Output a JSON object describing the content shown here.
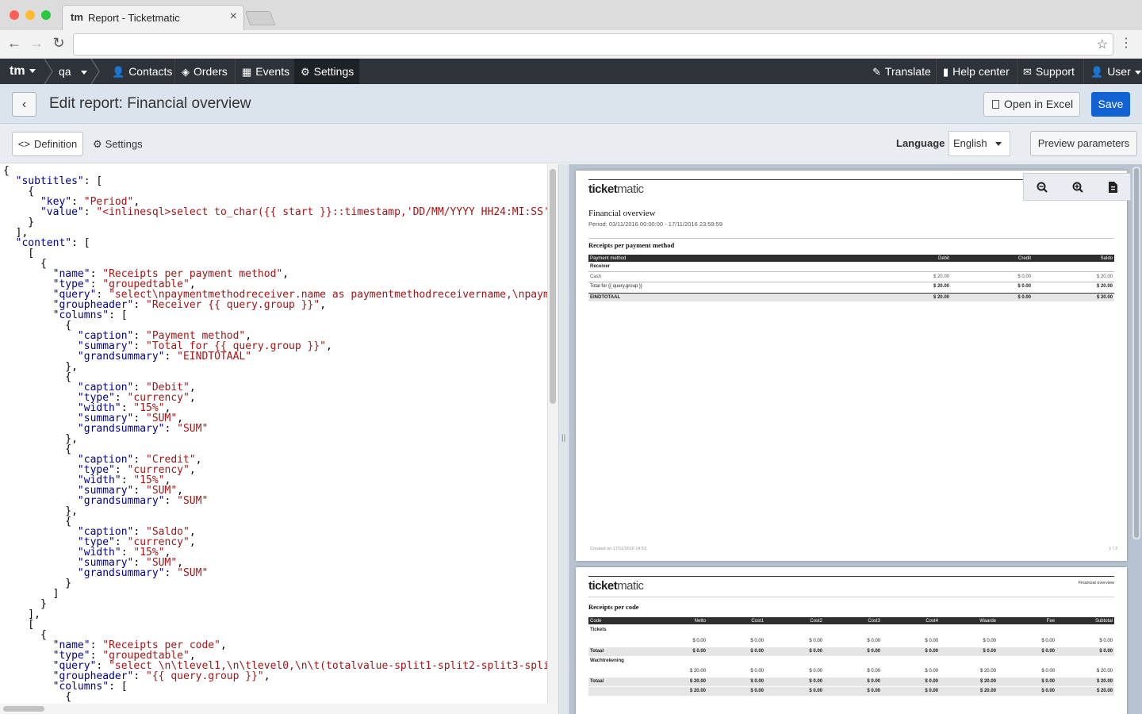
{
  "browser": {
    "tab_title": "Report - Ticketmatic",
    "tab_icon": "tm",
    "url": ""
  },
  "nav": {
    "brand": "tm",
    "account": "qa",
    "items": [
      {
        "label": "Contacts",
        "icon": "user-icon"
      },
      {
        "label": "Orders",
        "icon": "tag-icon"
      },
      {
        "label": "Events",
        "icon": "calendar-icon"
      },
      {
        "label": "Settings",
        "icon": "gear-icon"
      }
    ],
    "right": [
      {
        "label": "Translate",
        "icon": "pencil-icon"
      },
      {
        "label": "Help center",
        "icon": "book-icon"
      },
      {
        "label": "Support",
        "icon": "envelope-icon"
      },
      {
        "label": "User",
        "icon": "user-icon"
      }
    ]
  },
  "header": {
    "title": "Edit report: Financial overview",
    "open_excel": "Open in Excel",
    "save": "Save"
  },
  "subbar": {
    "definition": "Definition",
    "settings": "Settings",
    "language_label": "Language",
    "language_value": "English",
    "preview_params": "Preview parameters"
  },
  "editor": {
    "lines": [
      "{",
      "  \"subtitles\": [",
      "    {",
      "      \"key\": \"Period\",",
      "      \"value\": \"<inlinesql>select to_char({{ start }}::timestamp,'DD/MM/YYYY HH24:MI:SS'",
      "    }",
      "  ],",
      "  \"content\": [",
      "    [",
      "      {",
      "        \"name\": \"Receipts per payment method\",",
      "        \"type\": \"groupedtable\",",
      "        \"query\": \"select\\npaymentmethodreceiver.name as paymentmethodreceivername,\\npaym",
      "        \"groupheader\": \"Receiver {{ query.group }}\",",
      "        \"columns\": [",
      "          {",
      "            \"caption\": \"Payment method\",",
      "            \"summary\": \"Total for {{ query.group }}\",",
      "            \"grandsummary\": \"EINDTOTAAL\"",
      "          },",
      "          {",
      "            \"caption\": \"Debit\",",
      "            \"type\": \"currency\",",
      "            \"width\": \"15%\",",
      "            \"summary\": \"SUM\",",
      "            \"grandsummary\": \"SUM\"",
      "          },",
      "          {",
      "            \"caption\": \"Credit\",",
      "            \"type\": \"currency\",",
      "            \"width\": \"15%\",",
      "            \"summary\": \"SUM\",",
      "            \"grandsummary\": \"SUM\"",
      "          },",
      "          {",
      "            \"caption\": \"Saldo\",",
      "            \"type\": \"currency\",",
      "            \"width\": \"15%\",",
      "            \"summary\": \"SUM\",",
      "            \"grandsummary\": \"SUM\"",
      "          }",
      "        ]",
      "      }",
      "    ],",
      "    [",
      "      {",
      "        \"name\": \"Receipts per code\",",
      "        \"type\": \"groupedtable\",",
      "        \"query\": \"select \\n\\tlevel1,\\n\\tlevel0,\\n\\t(totalvalue-split1-split2-split3-spli",
      "        \"groupheader\": \"{{ query.group }}\",",
      "        \"columns\": [",
      "          {"
    ]
  },
  "preview": {
    "logo_a": "ticket",
    "logo_b": "matic",
    "page1": {
      "title": "Financial overview",
      "period": "Period: 03/11/2016 00:00:00 - 17/11/2016 23:59:59",
      "section": "Receipts per payment method",
      "headers": [
        "Payment method",
        "Debit",
        "Credit",
        "Saldo"
      ],
      "group": "Receiver",
      "rows": [
        [
          "Cash",
          "$ 20.00",
          "$ 0.00",
          "$ 20.00"
        ],
        [
          "Total for {{ query.group }}",
          "$ 20.00",
          "$ 0.00",
          "$ 20.00"
        ],
        [
          "EINDTOTAAL",
          "$ 20.00",
          "$ 0.00",
          "$ 20.00"
        ]
      ],
      "footer_left": "Created on 17/11/2016 14:53",
      "footer_right": "1 / 2"
    },
    "page2": {
      "header_right": "Financial overview",
      "section": "Receipts per code",
      "headers": [
        "Code",
        "Netto",
        "Cost1",
        "Cost2",
        "Cost3",
        "Cost4",
        "Waarde",
        "Fee",
        "Subtotal"
      ],
      "group1": "Tickets",
      "group1_rows": [
        [
          "",
          "$ 0.00",
          "$ 0.00",
          "$ 0.00",
          "$ 0.00",
          "$ 0.00",
          "$ 0.00",
          "$ 0.00",
          "$ 0.00"
        ],
        [
          "Totaal",
          "$ 0.00",
          "$ 0.00",
          "$ 0.00",
          "$ 0.00",
          "$ 0.00",
          "$ 0.00",
          "$ 0.00",
          "$ 0.00"
        ]
      ],
      "group2": "Wachtrekening",
      "group2_rows": [
        [
          "",
          "$ 20.00",
          "$ 0.00",
          "$ 0.00",
          "$ 0.00",
          "$ 0.00",
          "$ 20.00",
          "$ 0.00",
          "$ 20.00"
        ],
        [
          "Totaal",
          "$ 20.00",
          "$ 0.00",
          "$ 0.00",
          "$ 0.00",
          "$ 0.00",
          "$ 20.00",
          "$ 0.00",
          "$ 20.00"
        ],
        [
          "",
          "$ 20.00",
          "$ 0.00",
          "$ 0.00",
          "$ 0.00",
          "$ 0.00",
          "$ 20.00",
          "$ 0.00",
          "$ 20.00"
        ]
      ]
    }
  },
  "colors": {
    "nav_bg": "#2d3338",
    "primary": "#1262d4",
    "json_key": "#00008b",
    "json_string": "#a31515"
  }
}
